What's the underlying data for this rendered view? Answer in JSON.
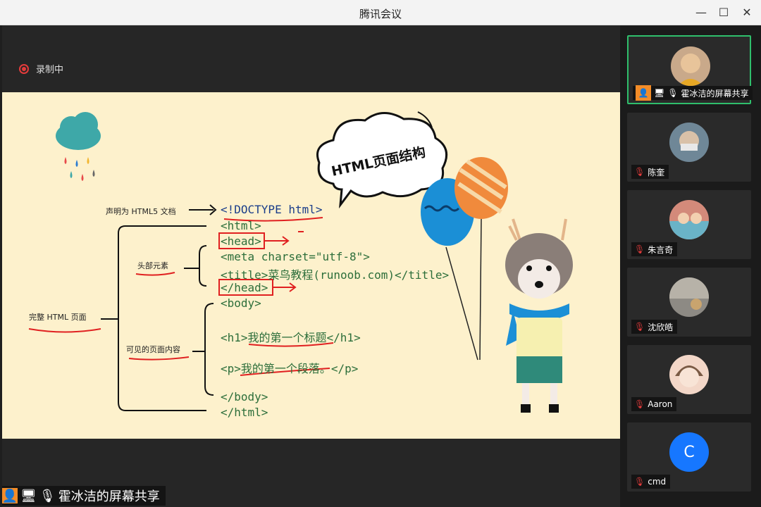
{
  "window": {
    "title": "腾讯会议"
  },
  "recording": {
    "label": "录制中"
  },
  "slide": {
    "heading": "HTML页面结构",
    "code_lines": [
      "<!DOCTYPE html>",
      "<html>",
      "<head>",
      "<meta charset=\"utf-8\">",
      "<title>菜鸟教程(runoob.com)</title>",
      "</head>",
      "<body>",
      "<h1>我的第一个标题</h1>",
      "<p>我的第一个段落。</p>",
      "</body>",
      "</html>"
    ],
    "labels": {
      "doctype": "声明为 HTML5 文档",
      "head": "头部元素",
      "whole": "完整 HTML 页面",
      "body": "可见的页面内容"
    }
  },
  "participants": [
    {
      "name": "霍冰洁的屏幕共享",
      "active": true,
      "muted": false,
      "initial": ""
    },
    {
      "name": "陈奎",
      "active": false,
      "muted": true,
      "initial": ""
    },
    {
      "name": "朱言奇",
      "active": false,
      "muted": true,
      "initial": ""
    },
    {
      "name": "沈欣皓",
      "active": false,
      "muted": true,
      "initial": ""
    },
    {
      "name": "Aaron",
      "active": false,
      "muted": true,
      "initial": ""
    },
    {
      "name": "cmd",
      "active": false,
      "muted": true,
      "initial": "C"
    }
  ],
  "share_bar": {
    "label": "霍冰洁的屏幕共享"
  },
  "colors": {
    "accent_green": "#2fbf6c",
    "record_red": "#e43b3b",
    "user_orange": "#f28c28",
    "avatar_blue": "#1677ff"
  }
}
